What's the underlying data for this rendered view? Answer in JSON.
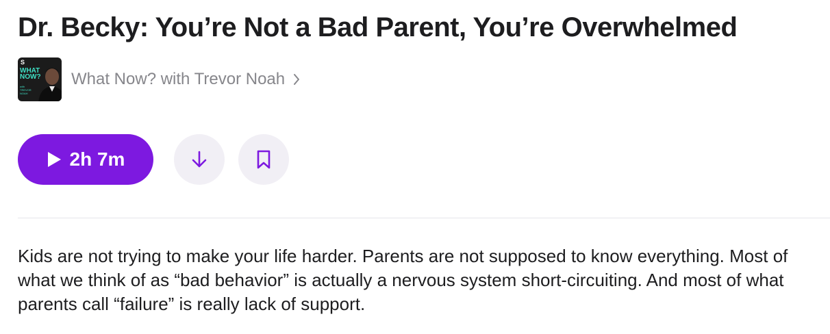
{
  "episode": {
    "title": "Dr. Becky: You’re Not a Bad Parent, You’re Overwhelmed",
    "description": "Kids are not trying to make your life harder. Parents are not supposed to know everything. Most of what we think of as “bad behavior” is actually a nervous system short-circuiting. And most of what parents call “failure” is really lack of support."
  },
  "show": {
    "name": "What Now? with Trevor Noah",
    "artwork_lines": [
      "S",
      "WHAT",
      "NOW?",
      "with",
      "TREVOR",
      "NOAH"
    ],
    "artwork_icon": "podcast-artwork"
  },
  "actions": {
    "play_duration": "2h 7m",
    "play_icon": "play-icon",
    "download_icon": "download-arrow-icon",
    "bookmark_icon": "bookmark-icon"
  },
  "colors": {
    "accent": "#7d19e0",
    "circle_button_bg": "#f1eff5",
    "secondary_text": "#86868b",
    "artwork_teal": "#3fe0c5"
  }
}
